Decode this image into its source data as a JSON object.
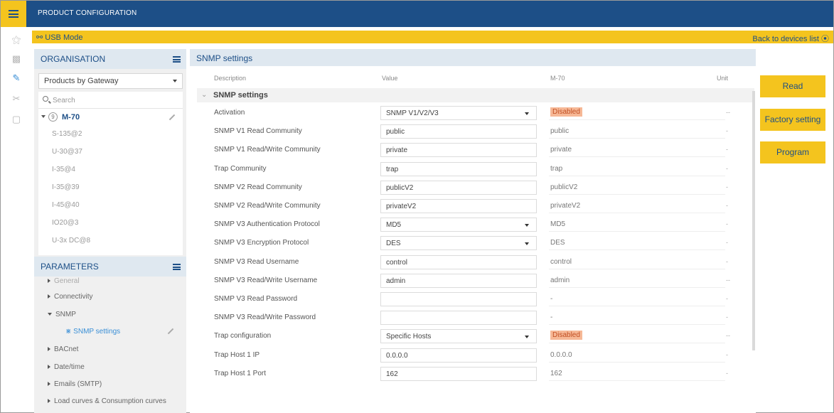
{
  "header": {
    "title": "PRODUCT CONFIGURATION"
  },
  "mode_bar": {
    "mode_label": "USB Mode",
    "back_label": "Back to devices list"
  },
  "rail_icons": [
    "network-icon",
    "devices-icon",
    "wrench-icon",
    "scissors-icon",
    "clipboard-icon"
  ],
  "organisation": {
    "title": "ORGANISATION",
    "select_value": "Products by Gateway",
    "search_placeholder": "Search",
    "root_badge": "9",
    "root_name": "M-70",
    "devices": [
      "S-135@2",
      "U-30@37",
      "I-35@4",
      "I-35@39",
      "I-45@40",
      "IO20@3",
      "U-3x DC@8"
    ]
  },
  "parameters": {
    "title": "PARAMETERS",
    "items": [
      "General",
      "Connectivity",
      "SNMP",
      "SNMP settings",
      "BACnet",
      "Date/time",
      "Emails (SMTP)",
      "Load curves & Consumption curves"
    ]
  },
  "main": {
    "title": "SNMP settings",
    "columns": {
      "description": "Description",
      "value": "Value",
      "device": "M-70",
      "unit": "Unit"
    },
    "section_label": "SNMP settings",
    "rows": [
      {
        "desc": "Activation",
        "value": "SNMP V1/V2/V3",
        "current": "Disabled",
        "unit": "--"
      },
      {
        "desc": "SNMP V1 Read Community",
        "value": "public",
        "current": "public",
        "unit": "-"
      },
      {
        "desc": "SNMP V1 Read/Write Community",
        "value": "private",
        "current": "private",
        "unit": "-"
      },
      {
        "desc": "Trap Community",
        "value": "trap",
        "current": "trap",
        "unit": "-"
      },
      {
        "desc": "SNMP V2 Read Community",
        "value": "publicV2",
        "current": "publicV2",
        "unit": "-"
      },
      {
        "desc": "SNMP V2 Read/Write Community",
        "value": "privateV2",
        "current": "privateV2",
        "unit": "-"
      },
      {
        "desc": "SNMP V3 Authentication Protocol",
        "value": "MD5",
        "current": "MD5",
        "unit": "-"
      },
      {
        "desc": "SNMP V3 Encryption Protocol",
        "value": "DES",
        "current": "DES",
        "unit": "-"
      },
      {
        "desc": "SNMP V3 Read Username",
        "value": "control",
        "current": "control",
        "unit": "-"
      },
      {
        "desc": "SNMP V3 Read/Write Username",
        "value": "admin",
        "current": "admin",
        "unit": "--"
      },
      {
        "desc": "SNMP V3 Read Password",
        "value": "",
        "current": "-",
        "unit": "-"
      },
      {
        "desc": "SNMP V3 Read/Write Password",
        "value": "",
        "current": "-",
        "unit": "-"
      },
      {
        "desc": "Trap configuration",
        "value": "Specific Hosts",
        "current": "Disabled",
        "unit": "--"
      },
      {
        "desc": "Trap Host 1 IP",
        "value": "0.0.0.0",
        "current": "0.0.0.0",
        "unit": "-"
      },
      {
        "desc": "Trap Host 1 Port",
        "value": "162",
        "current": "162",
        "unit": "-"
      }
    ]
  },
  "actions": {
    "read": "Read",
    "factory": "Factory setting",
    "program": "Program"
  },
  "colors": {
    "brand_blue": "#1d4f87",
    "accent_yellow": "#f4c41e",
    "warning_bg": "#f6b896",
    "link_blue": "#3a8fd6"
  }
}
